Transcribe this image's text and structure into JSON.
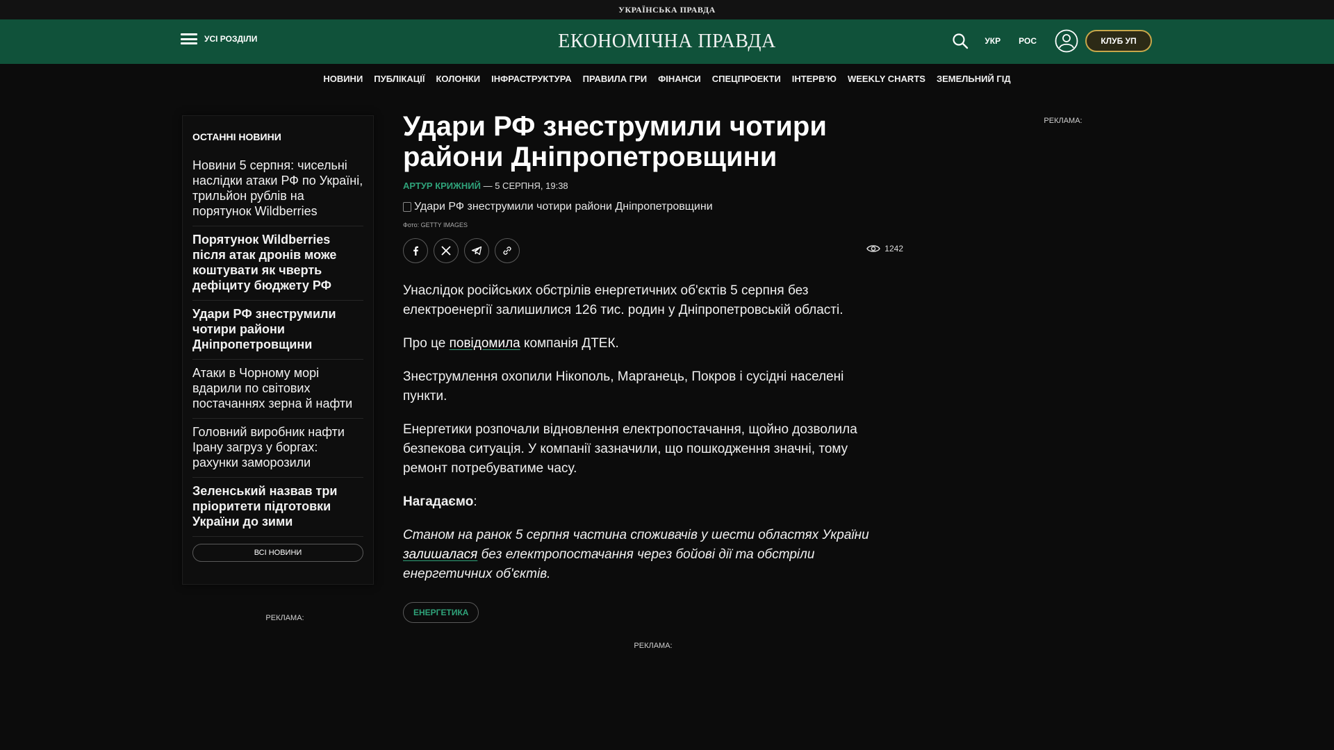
{
  "top_strip": {
    "brand": "УКРАЇНСЬКА ПРАВДА"
  },
  "header": {
    "menu_label": "УСІ РОЗДІЛИ",
    "logo": "ЕКОНОМІЧНА ПРАВДА",
    "lang_ukr": "УКР",
    "lang_ros": "РОС",
    "club_label": "КЛУБ УП",
    "accent": "#10523a"
  },
  "nav": {
    "items": [
      "НОВИНИ",
      "ПУБЛІКАЦІЇ",
      "КОЛОНКИ",
      "ІНФРАСТРУКТУРА",
      "ПРАВИЛА ГРИ",
      "ФІНАНСИ",
      "СПЕЦПРОЕКТИ",
      "ІНТЕРВ'Ю",
      "WEEKLY CHARTS",
      "ЗЕМЕЛЬНИЙ ГІД"
    ]
  },
  "sidebar": {
    "heading": "ОСТАННІ НОВИНИ",
    "items": [
      {
        "text": "Новини 5 серпня: чисельні наслідки атаки РФ по Україні, трильйон рублів на порятунок Wildberries",
        "bold": false
      },
      {
        "text": "Порятунок Wildberries після атак дронів може коштувати як чверть дефіциту бюджету РФ",
        "bold": true
      },
      {
        "text": "Удари РФ знеструмили чотири райони Дніпропетровщини",
        "bold": true
      },
      {
        "text": "Атаки в Чорному морі вдарили по світових постачаннях зерна й нафти",
        "bold": false
      },
      {
        "text": "Головний виробник нафти Ірану загруз у боргах: рахунки заморозили",
        "bold": false
      },
      {
        "text": "Зеленський назвав три пріоритети підготовки України до зими",
        "bold": true
      }
    ],
    "all_news": "ВСІ НОВИНИ"
  },
  "ads": {
    "label": "РЕКЛАМА:"
  },
  "article": {
    "title": "Удари РФ знеструмили чотири райони Дніпропетровщини",
    "author": "АРТУР КРИЖНИЙ",
    "date": " — 5 СЕРПНЯ, 19:38",
    "image_alt": "Удари РФ знеструмили чотири райони Дніпропетровщини",
    "photo_credit": "Фото: GETTY IMAGES",
    "views": "1242",
    "p1": "Унаслідок російських обстрілів енергетичних об'єктів 5 серпня без електроенергії залишилися 126 тис. родин у Дніпропетровській області.",
    "p2_before": "Про це ",
    "p2_link": "повідомила",
    "p2_after": " компанія ДТЕК.",
    "p3": "Знеструмлення охопили Нікополь, Марганець, Покров і сусідні населені пункти.",
    "p4": "Енергетики розпочали відновлення електропостачання, щойно дозволила безпекова ситуація. У компанії зазначили, що пошкодження значні, тому ремонт потребуватиме часу.",
    "reminder": "Нагадаємо",
    "reminder_colon": ":",
    "p5_before": "Станом на ранок 5 серпня частина споживачів у шести областях України ",
    "p5_link": "залишалася",
    "p5_after": " без електропостачання через бойові дії та обстріли енергетичних об'єктів.",
    "tag": "ЕНЕРГЕТИКА"
  }
}
